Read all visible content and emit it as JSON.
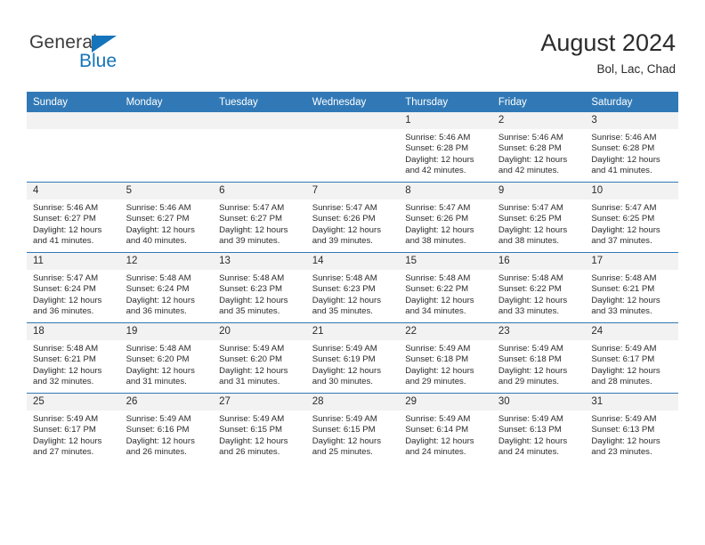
{
  "brand": {
    "name_part1": "General",
    "name_part2": "Blue"
  },
  "header": {
    "title": "August 2024",
    "subtitle": "Bol, Lac, Chad"
  },
  "colors": {
    "header_blue": "#3179b6",
    "brand_blue": "#1574bb",
    "daynum_bg": "#f2f2f2",
    "text": "#2b2b2b"
  },
  "weekdays": [
    "Sunday",
    "Monday",
    "Tuesday",
    "Wednesday",
    "Thursday",
    "Friday",
    "Saturday"
  ],
  "weeks": [
    [
      {
        "day": "",
        "empty": true,
        "sunrise": "",
        "sunset": "",
        "daylight1": "",
        "daylight2": ""
      },
      {
        "day": "",
        "empty": true,
        "sunrise": "",
        "sunset": "",
        "daylight1": "",
        "daylight2": ""
      },
      {
        "day": "",
        "empty": true,
        "sunrise": "",
        "sunset": "",
        "daylight1": "",
        "daylight2": ""
      },
      {
        "day": "",
        "empty": true,
        "sunrise": "",
        "sunset": "",
        "daylight1": "",
        "daylight2": ""
      },
      {
        "day": "1",
        "sunrise": "Sunrise: 5:46 AM",
        "sunset": "Sunset: 6:28 PM",
        "daylight1": "Daylight: 12 hours",
        "daylight2": "and 42 minutes."
      },
      {
        "day": "2",
        "sunrise": "Sunrise: 5:46 AM",
        "sunset": "Sunset: 6:28 PM",
        "daylight1": "Daylight: 12 hours",
        "daylight2": "and 42 minutes."
      },
      {
        "day": "3",
        "sunrise": "Sunrise: 5:46 AM",
        "sunset": "Sunset: 6:28 PM",
        "daylight1": "Daylight: 12 hours",
        "daylight2": "and 41 minutes."
      }
    ],
    [
      {
        "day": "4",
        "sunrise": "Sunrise: 5:46 AM",
        "sunset": "Sunset: 6:27 PM",
        "daylight1": "Daylight: 12 hours",
        "daylight2": "and 41 minutes."
      },
      {
        "day": "5",
        "sunrise": "Sunrise: 5:46 AM",
        "sunset": "Sunset: 6:27 PM",
        "daylight1": "Daylight: 12 hours",
        "daylight2": "and 40 minutes."
      },
      {
        "day": "6",
        "sunrise": "Sunrise: 5:47 AM",
        "sunset": "Sunset: 6:27 PM",
        "daylight1": "Daylight: 12 hours",
        "daylight2": "and 39 minutes."
      },
      {
        "day": "7",
        "sunrise": "Sunrise: 5:47 AM",
        "sunset": "Sunset: 6:26 PM",
        "daylight1": "Daylight: 12 hours",
        "daylight2": "and 39 minutes."
      },
      {
        "day": "8",
        "sunrise": "Sunrise: 5:47 AM",
        "sunset": "Sunset: 6:26 PM",
        "daylight1": "Daylight: 12 hours",
        "daylight2": "and 38 minutes."
      },
      {
        "day": "9",
        "sunrise": "Sunrise: 5:47 AM",
        "sunset": "Sunset: 6:25 PM",
        "daylight1": "Daylight: 12 hours",
        "daylight2": "and 38 minutes."
      },
      {
        "day": "10",
        "sunrise": "Sunrise: 5:47 AM",
        "sunset": "Sunset: 6:25 PM",
        "daylight1": "Daylight: 12 hours",
        "daylight2": "and 37 minutes."
      }
    ],
    [
      {
        "day": "11",
        "sunrise": "Sunrise: 5:47 AM",
        "sunset": "Sunset: 6:24 PM",
        "daylight1": "Daylight: 12 hours",
        "daylight2": "and 36 minutes."
      },
      {
        "day": "12",
        "sunrise": "Sunrise: 5:48 AM",
        "sunset": "Sunset: 6:24 PM",
        "daylight1": "Daylight: 12 hours",
        "daylight2": "and 36 minutes."
      },
      {
        "day": "13",
        "sunrise": "Sunrise: 5:48 AM",
        "sunset": "Sunset: 6:23 PM",
        "daylight1": "Daylight: 12 hours",
        "daylight2": "and 35 minutes."
      },
      {
        "day": "14",
        "sunrise": "Sunrise: 5:48 AM",
        "sunset": "Sunset: 6:23 PM",
        "daylight1": "Daylight: 12 hours",
        "daylight2": "and 35 minutes."
      },
      {
        "day": "15",
        "sunrise": "Sunrise: 5:48 AM",
        "sunset": "Sunset: 6:22 PM",
        "daylight1": "Daylight: 12 hours",
        "daylight2": "and 34 minutes."
      },
      {
        "day": "16",
        "sunrise": "Sunrise: 5:48 AM",
        "sunset": "Sunset: 6:22 PM",
        "daylight1": "Daylight: 12 hours",
        "daylight2": "and 33 minutes."
      },
      {
        "day": "17",
        "sunrise": "Sunrise: 5:48 AM",
        "sunset": "Sunset: 6:21 PM",
        "daylight1": "Daylight: 12 hours",
        "daylight2": "and 33 minutes."
      }
    ],
    [
      {
        "day": "18",
        "sunrise": "Sunrise: 5:48 AM",
        "sunset": "Sunset: 6:21 PM",
        "daylight1": "Daylight: 12 hours",
        "daylight2": "and 32 minutes."
      },
      {
        "day": "19",
        "sunrise": "Sunrise: 5:48 AM",
        "sunset": "Sunset: 6:20 PM",
        "daylight1": "Daylight: 12 hours",
        "daylight2": "and 31 minutes."
      },
      {
        "day": "20",
        "sunrise": "Sunrise: 5:49 AM",
        "sunset": "Sunset: 6:20 PM",
        "daylight1": "Daylight: 12 hours",
        "daylight2": "and 31 minutes."
      },
      {
        "day": "21",
        "sunrise": "Sunrise: 5:49 AM",
        "sunset": "Sunset: 6:19 PM",
        "daylight1": "Daylight: 12 hours",
        "daylight2": "and 30 minutes."
      },
      {
        "day": "22",
        "sunrise": "Sunrise: 5:49 AM",
        "sunset": "Sunset: 6:18 PM",
        "daylight1": "Daylight: 12 hours",
        "daylight2": "and 29 minutes."
      },
      {
        "day": "23",
        "sunrise": "Sunrise: 5:49 AM",
        "sunset": "Sunset: 6:18 PM",
        "daylight1": "Daylight: 12 hours",
        "daylight2": "and 29 minutes."
      },
      {
        "day": "24",
        "sunrise": "Sunrise: 5:49 AM",
        "sunset": "Sunset: 6:17 PM",
        "daylight1": "Daylight: 12 hours",
        "daylight2": "and 28 minutes."
      }
    ],
    [
      {
        "day": "25",
        "sunrise": "Sunrise: 5:49 AM",
        "sunset": "Sunset: 6:17 PM",
        "daylight1": "Daylight: 12 hours",
        "daylight2": "and 27 minutes."
      },
      {
        "day": "26",
        "sunrise": "Sunrise: 5:49 AM",
        "sunset": "Sunset: 6:16 PM",
        "daylight1": "Daylight: 12 hours",
        "daylight2": "and 26 minutes."
      },
      {
        "day": "27",
        "sunrise": "Sunrise: 5:49 AM",
        "sunset": "Sunset: 6:15 PM",
        "daylight1": "Daylight: 12 hours",
        "daylight2": "and 26 minutes."
      },
      {
        "day": "28",
        "sunrise": "Sunrise: 5:49 AM",
        "sunset": "Sunset: 6:15 PM",
        "daylight1": "Daylight: 12 hours",
        "daylight2": "and 25 minutes."
      },
      {
        "day": "29",
        "sunrise": "Sunrise: 5:49 AM",
        "sunset": "Sunset: 6:14 PM",
        "daylight1": "Daylight: 12 hours",
        "daylight2": "and 24 minutes."
      },
      {
        "day": "30",
        "sunrise": "Sunrise: 5:49 AM",
        "sunset": "Sunset: 6:13 PM",
        "daylight1": "Daylight: 12 hours",
        "daylight2": "and 24 minutes."
      },
      {
        "day": "31",
        "sunrise": "Sunrise: 5:49 AM",
        "sunset": "Sunset: 6:13 PM",
        "daylight1": "Daylight: 12 hours",
        "daylight2": "and 23 minutes."
      }
    ]
  ]
}
